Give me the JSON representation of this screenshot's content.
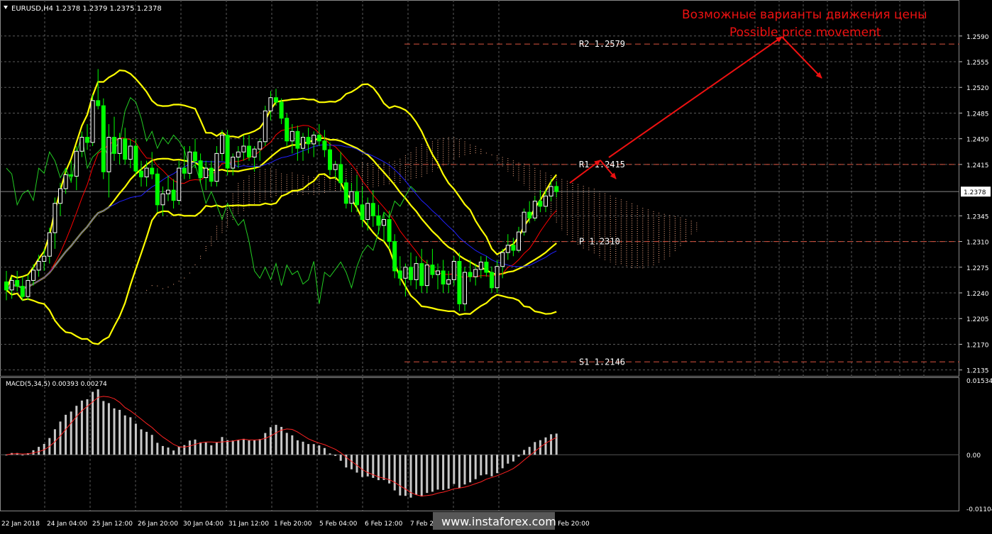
{
  "header": {
    "symbol_line": "EURUSD,H4  1.2378  1.2379  1.2375  1.2378"
  },
  "annotation": {
    "title_ru": "Возможные варианты движения цены",
    "title_en": "Possible price movement"
  },
  "levels": [
    {
      "name": "R2",
      "value": 1.2579,
      "label": "R2  1.2579",
      "color": "#d8533f"
    },
    {
      "name": "R1",
      "value": 1.2415,
      "label": "R1  1.2415",
      "color": "#d8533f"
    },
    {
      "name": "P",
      "value": 1.231,
      "label": "P  1.2310",
      "color": "#d8533f"
    },
    {
      "name": "S1",
      "value": 1.2146,
      "label": "S1  1.2146",
      "color": "#d8533f"
    }
  ],
  "current_price": "1.2378",
  "price_axis": {
    "ticks": [
      "1.2590",
      "1.2555",
      "1.2520",
      "1.2485",
      "1.2450",
      "1.2415",
      "1.2345",
      "1.2310",
      "1.2275",
      "1.2240",
      "1.2205",
      "1.2170",
      "1.2135"
    ],
    "ylim": [
      1.2126,
      1.2612
    ]
  },
  "macd": {
    "label": "MACD(5,34,5) 0.00393 0.00274",
    "ticks": [
      "0.01534",
      "0.00",
      "-0.01104"
    ],
    "ylim": [
      -0.0115,
      0.0158
    ]
  },
  "time_axis": [
    "22 Jan 2018",
    "24 Jan 04:00",
    "25 Jan 12:00",
    "26 Jan 20:00",
    "30 Jan 04:00",
    "31 Jan 12:00",
    "1 Feb 20:00",
    "5 Feb 04:00",
    "6 Feb 12:00",
    "7 Feb 2",
    "Feb 20:00"
  ],
  "watermark": "www.instaforex.com",
  "colors": {
    "background": "#000000",
    "grid": "#5a5a5a",
    "bull_candle": "#ffffff",
    "bear_candle": "#00ff00",
    "bollinger": "#ffff00",
    "red_ma": "#ff0000",
    "blue_ma": "#2020ff",
    "chikou": "#22cc22",
    "cloud": "#ffb08a",
    "arrow": "#ee1111",
    "macd_hist": "#c8c8c8",
    "macd_signal": "#ff2222"
  },
  "chart_data": {
    "type": "candlestick",
    "title": "EURUSD,H4",
    "series": [
      {
        "name": "EURUSD,H4",
        "kind": "candles",
        "values": [
          [
            1.2255,
            1.227,
            1.223,
            1.2244
          ],
          [
            1.2244,
            1.2262,
            1.2232,
            1.2257
          ],
          [
            1.2257,
            1.227,
            1.2242,
            1.2249
          ],
          [
            1.2249,
            1.2262,
            1.2229,
            1.2235
          ],
          [
            1.2235,
            1.2265,
            1.223,
            1.2257
          ],
          [
            1.2257,
            1.2279,
            1.225,
            1.2271
          ],
          [
            1.2271,
            1.2292,
            1.2262,
            1.2283
          ],
          [
            1.2283,
            1.23,
            1.227,
            1.229
          ],
          [
            1.229,
            1.2329,
            1.228,
            1.2322
          ],
          [
            1.2322,
            1.237,
            1.23,
            1.2362
          ],
          [
            1.2362,
            1.239,
            1.2345,
            1.2382
          ],
          [
            1.2382,
            1.241,
            1.2375,
            1.2401
          ],
          [
            1.2401,
            1.242,
            1.239,
            1.2399
          ],
          [
            1.2399,
            1.244,
            1.238,
            1.2433
          ],
          [
            1.2433,
            1.246,
            1.2425,
            1.2452
          ],
          [
            1.2452,
            1.247,
            1.2435,
            1.2445
          ],
          [
            1.2445,
            1.251,
            1.244,
            1.2502
          ],
          [
            1.2502,
            1.2545,
            1.249,
            1.2495
          ],
          [
            1.2495,
            1.2505,
            1.2395,
            1.2405
          ],
          [
            1.2405,
            1.247,
            1.237,
            1.2452
          ],
          [
            1.2452,
            1.248,
            1.242,
            1.243
          ],
          [
            1.243,
            1.2458,
            1.2415,
            1.245
          ],
          [
            1.245,
            1.2465,
            1.2415,
            1.2422
          ],
          [
            1.2422,
            1.245,
            1.241,
            1.244
          ],
          [
            1.244,
            1.245,
            1.24,
            1.2406
          ],
          [
            1.2406,
            1.242,
            1.2385,
            1.2398
          ],
          [
            1.2398,
            1.242,
            1.2385,
            1.241
          ],
          [
            1.241,
            1.2432,
            1.2395,
            1.2402
          ],
          [
            1.2402,
            1.241,
            1.235,
            1.236
          ],
          [
            1.236,
            1.2385,
            1.2345,
            1.2375
          ],
          [
            1.2375,
            1.24,
            1.2365,
            1.238
          ],
          [
            1.238,
            1.2395,
            1.2355,
            1.2366
          ],
          [
            1.2366,
            1.242,
            1.236,
            1.241
          ],
          [
            1.241,
            1.244,
            1.2395,
            1.2403
          ],
          [
            1.2403,
            1.244,
            1.2395,
            1.2432
          ],
          [
            1.2432,
            1.245,
            1.241,
            1.242
          ],
          [
            1.242,
            1.243,
            1.239,
            1.2397
          ],
          [
            1.2397,
            1.242,
            1.238,
            1.241
          ],
          [
            1.241,
            1.242,
            1.2385,
            1.2392
          ],
          [
            1.2392,
            1.244,
            1.2385,
            1.243
          ],
          [
            1.243,
            1.2462,
            1.242,
            1.2455
          ],
          [
            1.2455,
            1.2462,
            1.24,
            1.241
          ],
          [
            1.241,
            1.243,
            1.24,
            1.2425
          ],
          [
            1.2425,
            1.244,
            1.241,
            1.2432
          ],
          [
            1.2432,
            1.2455,
            1.242,
            1.244
          ],
          [
            1.244,
            1.2455,
            1.242,
            1.2425
          ],
          [
            1.2425,
            1.244,
            1.2405,
            1.2436
          ],
          [
            1.2436,
            1.245,
            1.242,
            1.2446
          ],
          [
            1.2446,
            1.2495,
            1.244,
            1.2488
          ],
          [
            1.2488,
            1.2515,
            1.2475,
            1.2506
          ],
          [
            1.2506,
            1.2518,
            1.2495,
            1.25
          ],
          [
            1.25,
            1.2505,
            1.247,
            1.2478
          ],
          [
            1.2478,
            1.2485,
            1.244,
            1.2447
          ],
          [
            1.2447,
            1.247,
            1.243,
            1.246
          ],
          [
            1.246,
            1.2468,
            1.242,
            1.2437
          ],
          [
            1.2437,
            1.2458,
            1.242,
            1.2452
          ],
          [
            1.2452,
            1.2465,
            1.243,
            1.2443
          ],
          [
            1.2443,
            1.246,
            1.2425,
            1.2455
          ],
          [
            1.2455,
            1.247,
            1.244,
            1.2447
          ],
          [
            1.2447,
            1.2462,
            1.2425,
            1.2435
          ],
          [
            1.2435,
            1.2445,
            1.24,
            1.2408
          ],
          [
            1.2408,
            1.242,
            1.2395,
            1.2415
          ],
          [
            1.2415,
            1.2432,
            1.238,
            1.239
          ],
          [
            1.239,
            1.2395,
            1.2355,
            1.2362
          ],
          [
            1.2362,
            1.239,
            1.235,
            1.2378
          ],
          [
            1.2378,
            1.24,
            1.235,
            1.236
          ],
          [
            1.236,
            1.2385,
            1.233,
            1.234
          ],
          [
            1.234,
            1.237,
            1.2325,
            1.2362
          ],
          [
            1.2362,
            1.238,
            1.233,
            1.2345
          ],
          [
            1.2345,
            1.236,
            1.232,
            1.2332
          ],
          [
            1.2332,
            1.235,
            1.231,
            1.234
          ],
          [
            1.234,
            1.2352,
            1.23,
            1.231
          ],
          [
            1.231,
            1.232,
            1.226,
            1.227
          ],
          [
            1.227,
            1.229,
            1.225,
            1.226
          ],
          [
            1.226,
            1.228,
            1.2235,
            1.2275
          ],
          [
            1.2275,
            1.2295,
            1.225,
            1.2258
          ],
          [
            1.2258,
            1.229,
            1.2245,
            1.228
          ],
          [
            1.228,
            1.23,
            1.224,
            1.225
          ],
          [
            1.225,
            1.2285,
            1.224,
            1.2278
          ],
          [
            1.2278,
            1.23,
            1.226,
            1.2265
          ],
          [
            1.2265,
            1.228,
            1.2245,
            1.227
          ],
          [
            1.227,
            1.2285,
            1.224,
            1.2252
          ],
          [
            1.2252,
            1.227,
            1.224,
            1.2258
          ],
          [
            1.2258,
            1.229,
            1.225,
            1.2283
          ],
          [
            1.2283,
            1.2295,
            1.2215,
            1.2225
          ],
          [
            1.2225,
            1.2275,
            1.2215,
            1.2268
          ],
          [
            1.2268,
            1.2285,
            1.2255,
            1.2262
          ],
          [
            1.2262,
            1.228,
            1.225,
            1.2272
          ],
          [
            1.2272,
            1.229,
            1.226,
            1.2282
          ],
          [
            1.2282,
            1.229,
            1.2262,
            1.2268
          ],
          [
            1.2268,
            1.2276,
            1.224,
            1.2247
          ],
          [
            1.2247,
            1.2285,
            1.224,
            1.2276
          ],
          [
            1.2276,
            1.23,
            1.226,
            1.2295
          ],
          [
            1.2295,
            1.232,
            1.2285,
            1.2305
          ],
          [
            1.2305,
            1.2315,
            1.229,
            1.2298
          ],
          [
            1.2298,
            1.233,
            1.2295,
            1.2323
          ],
          [
            1.2323,
            1.2355,
            1.2318,
            1.235
          ],
          [
            1.235,
            1.2365,
            1.2335,
            1.2342
          ],
          [
            1.2342,
            1.2372,
            1.2338,
            1.2365
          ],
          [
            1.2365,
            1.238,
            1.235,
            1.2358
          ],
          [
            1.2358,
            1.238,
            1.235,
            1.2372
          ],
          [
            1.2372,
            1.2395,
            1.2365,
            1.2385
          ],
          [
            1.2385,
            1.2392,
            1.237,
            1.2378
          ]
        ]
      }
    ],
    "pivot_levels": {
      "R2": 1.2579,
      "R1": 1.2415,
      "P": 1.231,
      "S1": 1.2146
    },
    "indicators": [
      "Bollinger Bands",
      "Moving averages",
      "Ichimoku",
      "MACD(5,34,5)"
    ],
    "macd_values": {
      "main": 0.00393,
      "signal": 0.00274
    }
  }
}
